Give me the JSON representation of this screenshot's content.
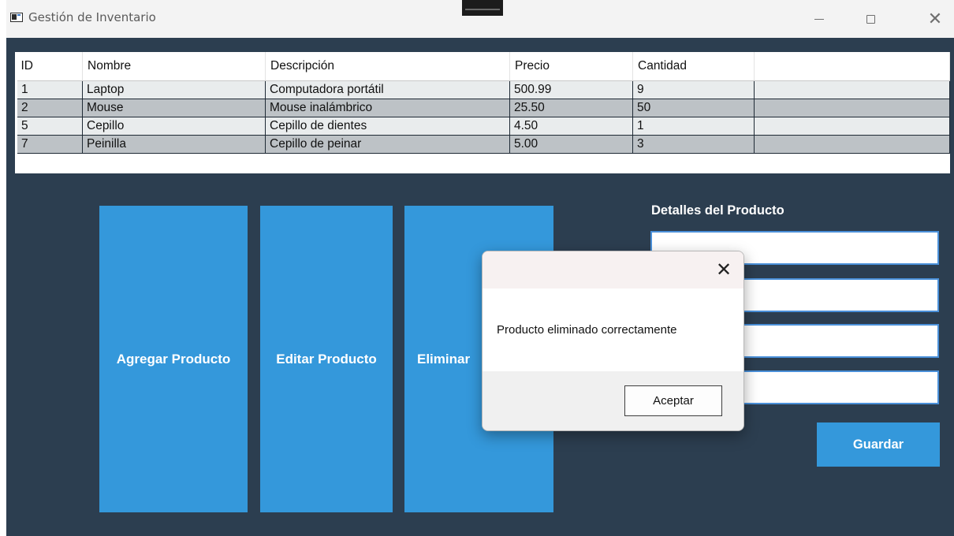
{
  "window": {
    "title": "Gestión de Inventario",
    "controls": {
      "minimize": "—",
      "maximize": "☐",
      "close": "✕"
    }
  },
  "grid": {
    "columns": [
      "ID",
      "Nombre",
      "Descripción",
      "Precio",
      "Cantidad"
    ],
    "rows": [
      [
        "1",
        "Laptop",
        "Computadora portátil",
        "500.99",
        "9"
      ],
      [
        "2",
        "Mouse",
        "Mouse inalámbrico",
        "25.50",
        "50"
      ],
      [
        "5",
        "Cepillo",
        "Cepillo de dientes",
        "4.50",
        "1"
      ],
      [
        "7",
        "Peinilla",
        "Cepillo de peinar",
        "5.00",
        "3"
      ]
    ]
  },
  "actions": {
    "add": "Agregar Producto",
    "edit": "Editar Producto",
    "delete": "Eliminar"
  },
  "details": {
    "title": "Detalles del Producto",
    "fields": [
      "",
      "",
      "",
      ""
    ],
    "save": "Guardar"
  },
  "dialog": {
    "close": "✕",
    "message": "Producto eliminado correctamente",
    "ok": "Aceptar"
  },
  "colors": {
    "background": "#2c3e50",
    "accent": "#3498db",
    "row_odd": "#e9eced",
    "row_even": "#bdc2c6"
  }
}
